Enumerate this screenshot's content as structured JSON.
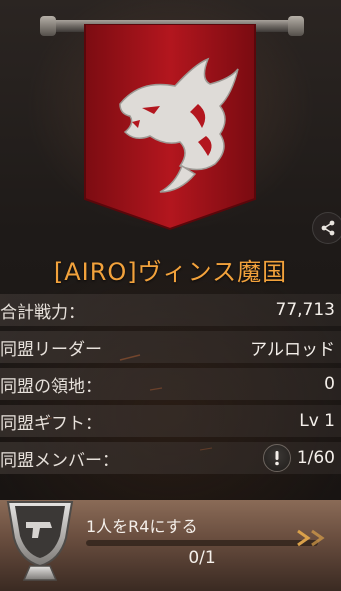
{
  "alliance": {
    "name": "[AIRO]ヴィンス魔国"
  },
  "rows": [
    {
      "label": "合計戦力：",
      "value": "77,713"
    },
    {
      "label": "同盟リーダー",
      "value": "アルロッド"
    },
    {
      "label": "同盟の領地：",
      "value": "0"
    },
    {
      "label": "同盟ギフト：",
      "value": "Lv 1"
    },
    {
      "label": "同盟メンバー：",
      "value": "1/60"
    }
  ],
  "mission": {
    "label": "1人をR4にする",
    "count": "0/1",
    "progress": 0
  },
  "colors": {
    "name": "#f2a23c",
    "banner": "#b0141c",
    "accent": "#d9a04a"
  },
  "icons": {
    "share": "share-icon",
    "warning": "exclamation-icon",
    "trophy": "trophy-pistol-icon",
    "arrows": "chevron-right-double-icon"
  }
}
